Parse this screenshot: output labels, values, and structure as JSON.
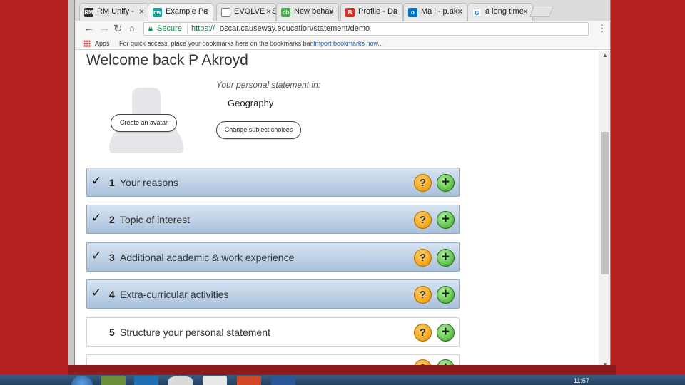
{
  "browser": {
    "tabs": [
      {
        "label": "RM Unify -",
        "favicon": "RM",
        "color": "#2b2b2b"
      },
      {
        "label": "Example Pe",
        "favicon": "cw",
        "color": "#1aa39a",
        "active": true
      },
      {
        "label": "EVOLVE - S",
        "favicon": "doc",
        "color": "#777777"
      },
      {
        "label": "New behav",
        "favicon": "cb",
        "color": "#4caf50"
      },
      {
        "label": "Profile - Da",
        "favicon": "B",
        "color": "#d93025"
      },
      {
        "label": "Ma l - p.ak",
        "favicon": "o",
        "color": "#0072c6"
      },
      {
        "label": "a long time",
        "favicon": "G",
        "color": "#4285f4"
      }
    ],
    "tab_close": "×",
    "address": {
      "secure_label": "Secure",
      "url_scheme": "https://",
      "url_rest": "oscar.causeway.education/statement/demo"
    },
    "bookmarks_bar": {
      "apps_label": "Apps",
      "hint": "For quick access, place your bookmarks here on the bookmarks bar.",
      "import_link": "Import bookmarks now..."
    }
  },
  "page": {
    "welcome": "Welcome back P Akroyd",
    "create_avatar_label": "Create an avatar",
    "statement_label": "Your personal statement in:",
    "subject": "Geography",
    "change_subject_label": "Change subject choices",
    "sections": [
      {
        "number": "1",
        "title": "Your reasons",
        "completed": true
      },
      {
        "number": "2",
        "title": "Topic of interest",
        "completed": true
      },
      {
        "number": "3",
        "title": "Additional academic & work experience",
        "completed": true
      },
      {
        "number": "4",
        "title": "Extra-curricular activities",
        "completed": true
      },
      {
        "number": "5",
        "title": "Structure your personal statement",
        "completed": false
      }
    ],
    "check_glyph": "✓",
    "help_glyph": "?",
    "add_glyph": "+"
  },
  "taskbar": {
    "clock": "11:57"
  },
  "colors": {
    "section_gradient_top": "#d6e3f1",
    "section_gradient_bottom": "#a9c1dc",
    "help_icon": "#f0a21a",
    "add_icon": "#5cc24a",
    "background": "#b31f1f"
  }
}
